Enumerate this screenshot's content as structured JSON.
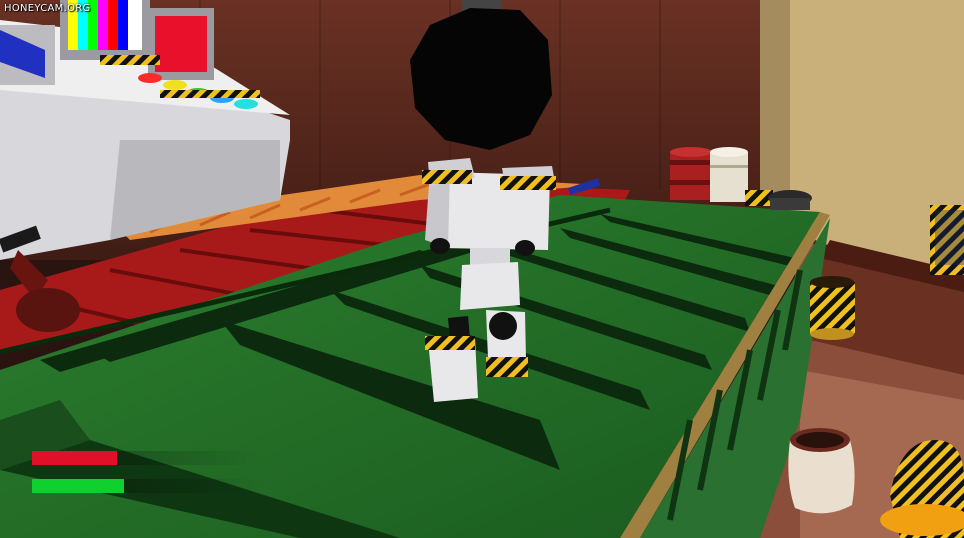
{
  "watermark": {
    "text": "HONEYCAM.ORG"
  },
  "hud": {
    "health": {
      "level": 0.37,
      "color": "#e0102a"
    },
    "stamina": {
      "level": 0.4,
      "color": "#10d030"
    }
  },
  "colors": {
    "conveyor_green": "#1f6a22",
    "conveyor_red": "#a01818",
    "hazard_yellow": "#f0c020",
    "wall_brown": "#5a2a1e",
    "robot_white": "#e8e8ea"
  }
}
